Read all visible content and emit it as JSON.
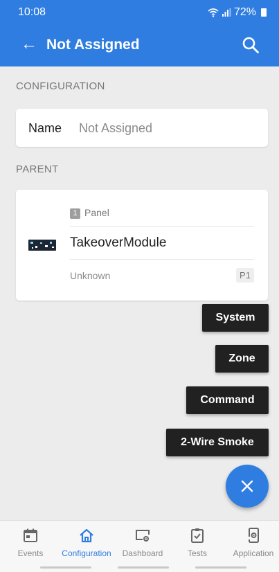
{
  "status_bar": {
    "time": "10:08",
    "battery": "72%"
  },
  "app_bar": {
    "title": "Not Assigned"
  },
  "configuration": {
    "section_label": "CONFIGURATION",
    "name_label": "Name",
    "name_value": "Not Assigned"
  },
  "parent": {
    "section_label": "PARENT",
    "panel_number": "1",
    "panel_label": "Panel",
    "module_name": "TakeoverModule",
    "status": "Unknown",
    "badge": "P1"
  },
  "fab_menu": {
    "items": [
      {
        "label": "System"
      },
      {
        "label": "Zone"
      },
      {
        "label": "Command"
      },
      {
        "label": "2-Wire Smoke"
      }
    ]
  },
  "bottom_nav": {
    "items": [
      {
        "label": "Events",
        "icon": "calendar-icon"
      },
      {
        "label": "Configuration",
        "icon": "home-icon",
        "active": true
      },
      {
        "label": "Dashboard",
        "icon": "monitor-gear-icon"
      },
      {
        "label": "Tests",
        "icon": "clipboard-check-icon"
      },
      {
        "label": "Application",
        "icon": "device-gear-icon"
      }
    ]
  },
  "colors": {
    "primary": "#2f7de1",
    "menu_bg": "#212121",
    "background": "#ececec"
  }
}
